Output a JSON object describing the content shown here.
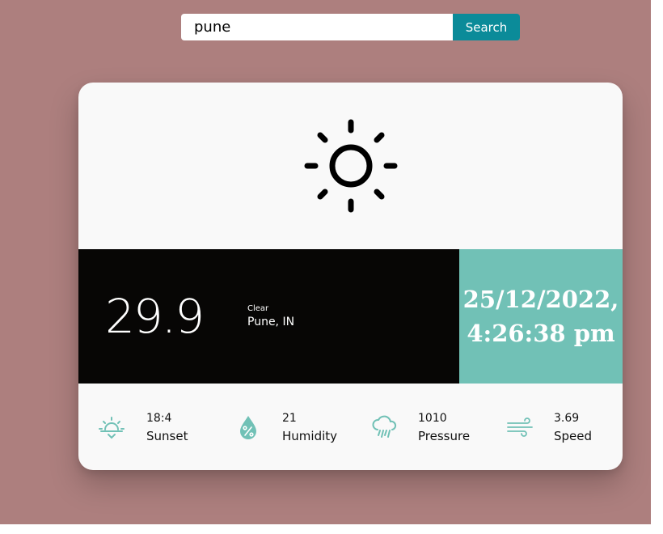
{
  "search": {
    "value": "pune",
    "button_label": "Search"
  },
  "weather": {
    "icon": "sun-icon",
    "temperature": "29.9",
    "condition": "Clear",
    "location": "Pune, IN",
    "datetime": "25/12/2022,\n4:26:38 pm"
  },
  "stats": [
    {
      "icon": "sunset-icon",
      "value": "18:4",
      "label": "Sunset"
    },
    {
      "icon": "humidity-icon",
      "value": "21",
      "label": "Humidity"
    },
    {
      "icon": "pressure-icon",
      "value": "1010",
      "label": "Pressure"
    },
    {
      "icon": "wind-icon",
      "value": "3.69",
      "label": "Speed"
    }
  ],
  "colors": {
    "background": "#ad7f7e",
    "accent": "#71c1b6",
    "search_button": "#0b8b99",
    "temperature_panel": "#070605",
    "card": "#f9f9f9"
  }
}
